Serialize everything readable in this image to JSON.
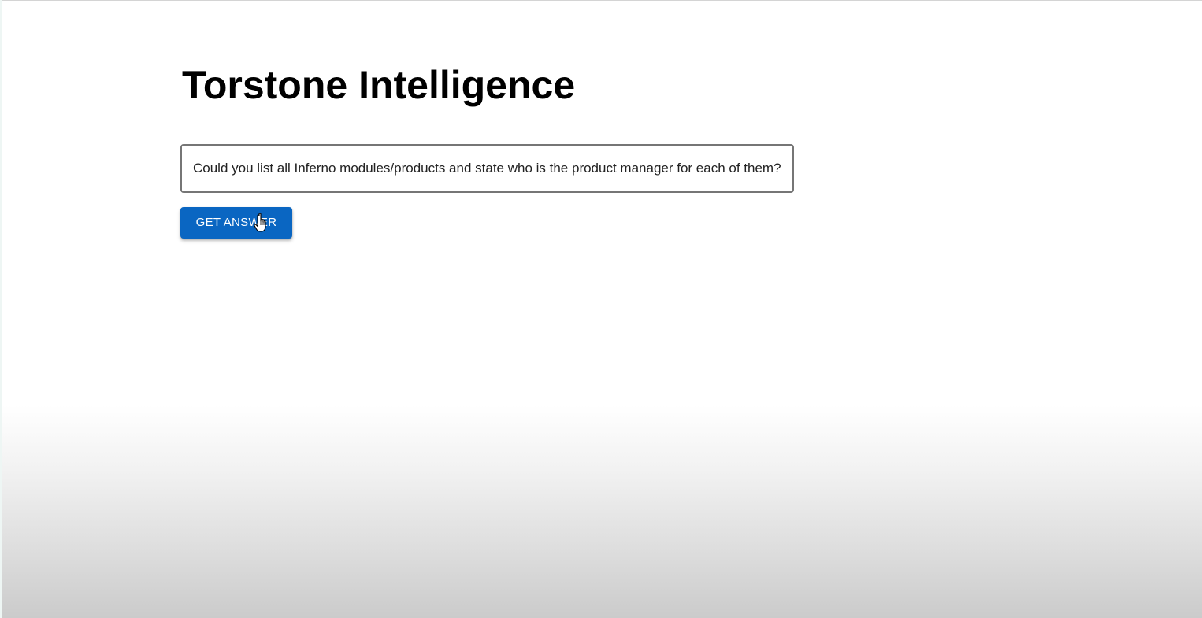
{
  "page": {
    "title": "Torstone Intelligence"
  },
  "question": {
    "value": "Could you list all Inferno modules/products and state who is the product manager for each of them?"
  },
  "actions": {
    "get_answer_label": "GET ANSWER"
  },
  "colors": {
    "accent": "#0a66c2",
    "text": "#000000",
    "input_border": "#767676"
  },
  "icons": {
    "cursor": "hand-pointer-icon"
  }
}
